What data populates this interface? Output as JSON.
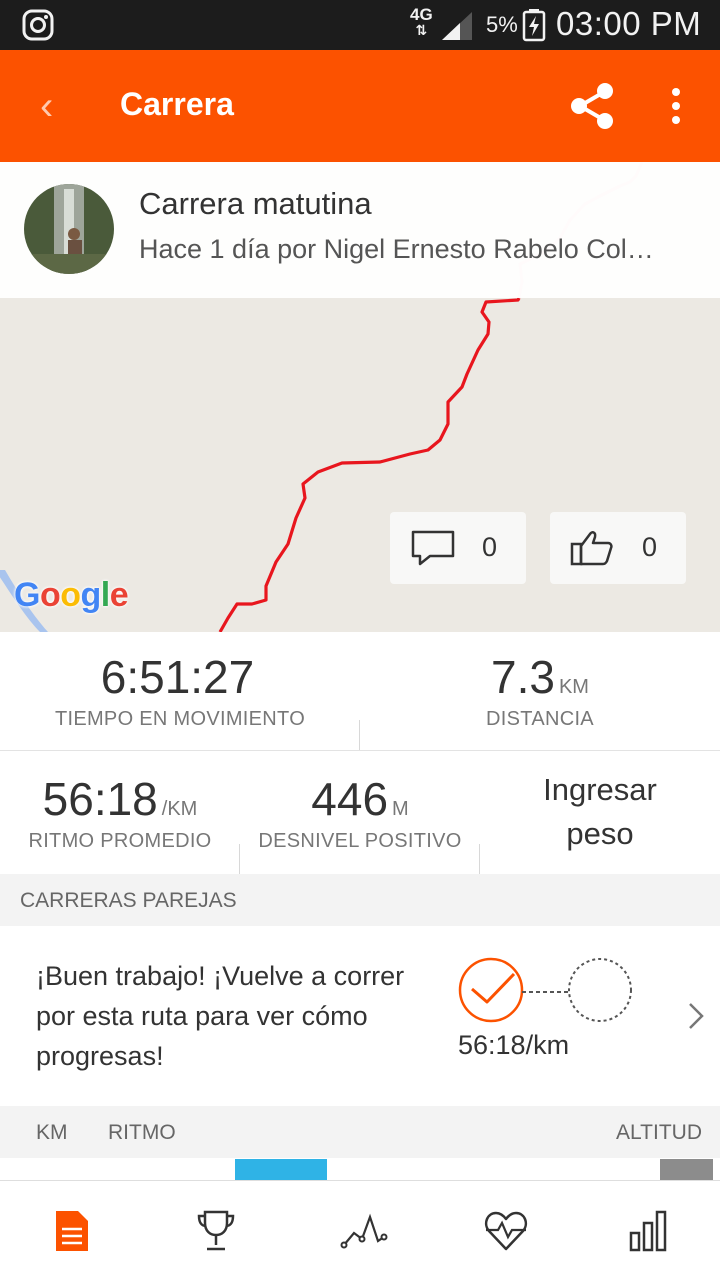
{
  "status_bar": {
    "network": "4G",
    "battery_percent": "5%",
    "time": "03:00 PM",
    "icons": [
      "instagram-icon",
      "signal-icon",
      "battery-charging-icon"
    ]
  },
  "app_bar": {
    "title": "Carrera",
    "background_color": "#fc5200",
    "icons": [
      "back-icon",
      "share-icon",
      "overflow-menu-icon"
    ]
  },
  "activity": {
    "name": "Carrera matutina",
    "subtitle": "Hace 1 día por Nigel Ernesto Rabelo Col…"
  },
  "map": {
    "attribution": "Google",
    "route_color": "#e8161e",
    "comments_count": "0",
    "kudos_count": "0"
  },
  "stats": {
    "moving_time": {
      "value": "6:51:27",
      "label": "TIEMPO EN MOVIMIENTO"
    },
    "distance": {
      "value": "7.3",
      "unit": "KM",
      "label": "DISTANCIA"
    },
    "pace": {
      "value": "56:18",
      "unit": "/KM",
      "label": "RITMO PROMEDIO"
    },
    "elevation": {
      "value": "446",
      "unit": "M",
      "label": "DESNIVEL POSITIVO"
    },
    "weight_prompt": "Ingresar peso"
  },
  "matched_runs": {
    "header": "CARRERAS PAREJAS",
    "message": "¡Buen trabajo! ¡Vuelve a correr por esta ruta para ver cómo progresas!",
    "pace": "56:18/km",
    "accent_color": "#fc5200"
  },
  "splits": {
    "col_km": "KM",
    "col_pace": "RITMO",
    "col_altitude": "ALTITUD",
    "pace_bar_color": "#2fb3e6"
  },
  "bottom_nav": {
    "items": [
      "feed-icon",
      "trophy-icon",
      "activity-graph-icon",
      "heart-rate-icon",
      "stats-icon"
    ],
    "active_color": "#fc5200"
  }
}
